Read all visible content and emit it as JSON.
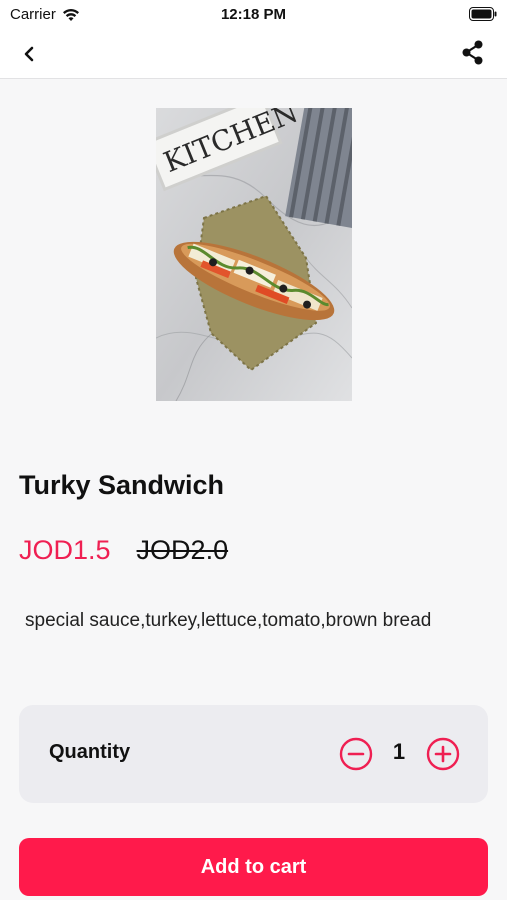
{
  "status_bar": {
    "carrier": "Carrier",
    "time": "12:18 PM"
  },
  "nav": {
    "back_icon": "chevron-left-icon",
    "share_icon": "share-icon"
  },
  "product": {
    "image_alt": "Turkey sandwich on burlap cloth with KITCHEN sign",
    "image_sign_text": "KITCHEN",
    "title": "Turky Sandwich",
    "price": "JOD1.5",
    "original_price": "JOD2.0",
    "description": "special sauce,turkey,lettuce,tomato,brown bread"
  },
  "quantity": {
    "label": "Quantity",
    "value": "1"
  },
  "cart": {
    "button_label": "Add to cart"
  },
  "colors": {
    "accent": "#ff1a4b",
    "price": "#ef1f52",
    "card_bg": "#ececf0",
    "page_bg": "#f7f7f8"
  }
}
